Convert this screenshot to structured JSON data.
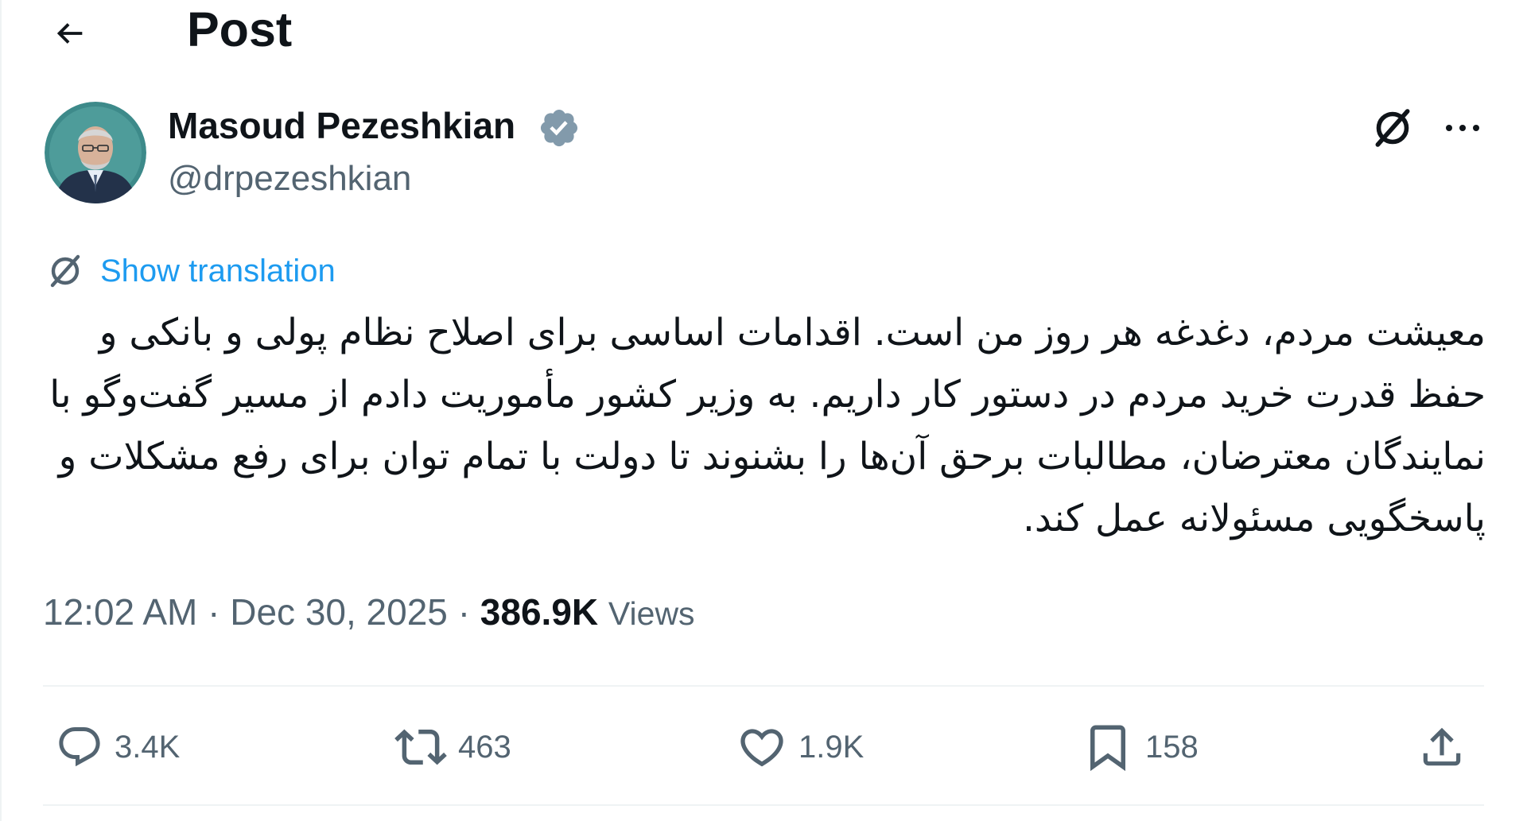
{
  "header": {
    "title": "Post"
  },
  "author": {
    "name": "Masoud Pezeshkian",
    "handle": "@drpezeshkian"
  },
  "translation": {
    "label": "Show translation"
  },
  "tweet": {
    "text": "معیشت مردم، دغدغه هر روز من است. اقدامات اساسی برای اصلاح نظام پولی و بانکی و حفظ قدرت خرید مردم در دستور کار داریم. به وزیر کشور مأموریت دادم از مسیر گفت‌وگو با نمایندگان معترضان، مطالبات برحق آن‌ها را بشنوند تا دولت با تمام توان برای رفع مشکلات و پاسخگویی مسئولانه عمل کند."
  },
  "meta": {
    "time": "12:02 AM",
    "date": "Dec 30, 2025",
    "views_count": "386.9K",
    "views_label": "Views"
  },
  "actions": {
    "replies": "3.4K",
    "reposts": "463",
    "likes": "1.9K",
    "bookmarks": "158"
  },
  "colors": {
    "link": "#1d9bf0",
    "secondary_text": "#536471",
    "primary_text": "#0f1419",
    "verified_badge": "#829aab",
    "divider": "#eff3f4"
  },
  "icons": [
    "back-arrow-icon",
    "verified-badge-icon",
    "grok-icon",
    "more-icon",
    "translate-icon",
    "reply-icon",
    "repost-icon",
    "like-icon",
    "bookmark-icon",
    "share-icon"
  ]
}
